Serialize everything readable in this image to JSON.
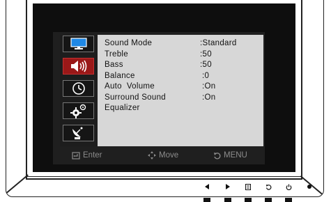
{
  "osd": {
    "icons": [
      "monitor-icon",
      "speaker-icon",
      "clock-icon",
      "settings-gears-icon",
      "satellite-icon"
    ],
    "active_icon": 1,
    "active_color": "#9a1818",
    "items": [
      {
        "label": "Sound Mode",
        "value": ":Standard"
      },
      {
        "label": "Treble",
        "value": ":50"
      },
      {
        "label": "Bass",
        "value": ":50"
      },
      {
        "label": "Balance",
        "value": ":0"
      },
      {
        "label": "Auto  Volume",
        "value": ":On"
      },
      {
        "label": "Surround Sound",
        "value": ":On"
      },
      {
        "label": "Equalizer",
        "value": ""
      }
    ],
    "footer": {
      "enter": "Enter",
      "move": "Move",
      "menu": "MENU"
    }
  },
  "buttons": [
    "left-icon",
    "right-icon",
    "input-source-icon",
    "menu-icon",
    "power-icon"
  ]
}
